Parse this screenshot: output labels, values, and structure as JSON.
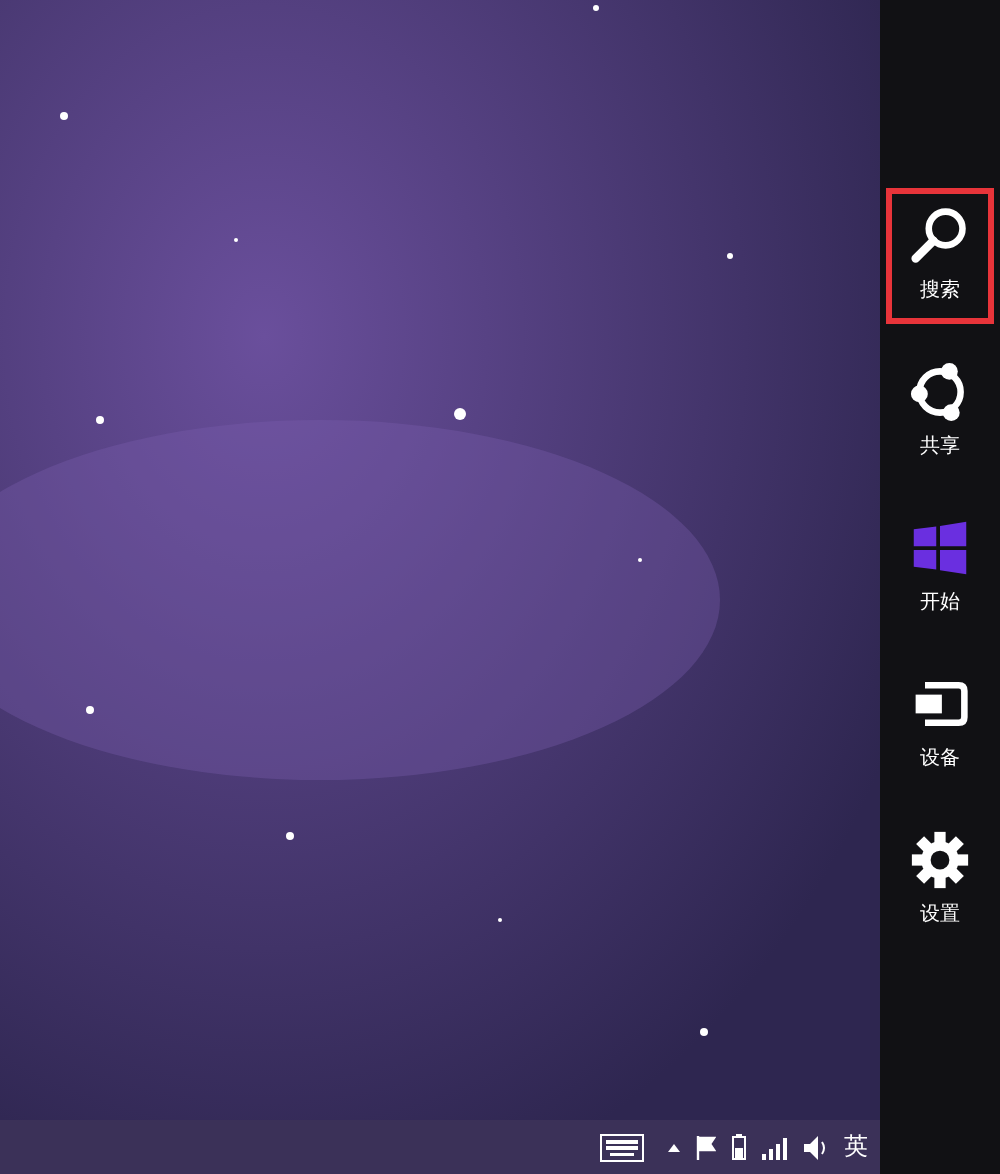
{
  "charms": [
    {
      "kind": "search",
      "label": "搜索",
      "selected": true
    },
    {
      "kind": "share",
      "label": "共享",
      "selected": false
    },
    {
      "kind": "start",
      "label": "开始",
      "selected": false
    },
    {
      "kind": "devices",
      "label": "设备",
      "selected": false
    },
    {
      "kind": "settings",
      "label": "设置",
      "selected": false
    }
  ],
  "taskbar": {
    "language": "英"
  }
}
